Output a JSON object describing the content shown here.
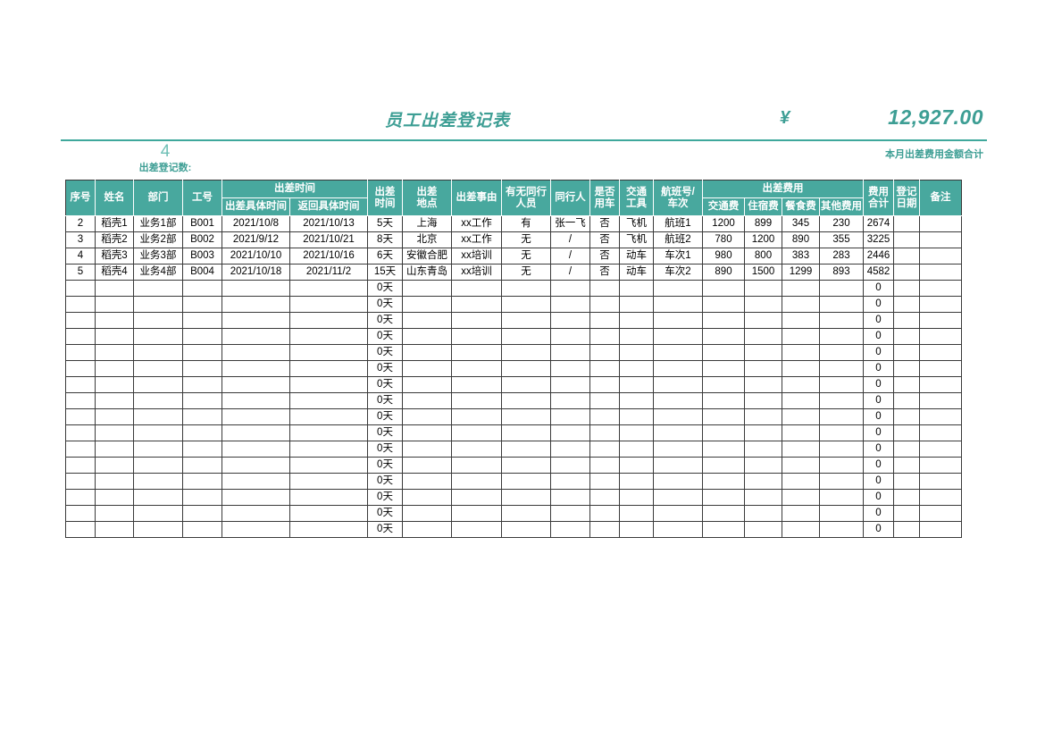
{
  "header": {
    "title": "员工出差登记表",
    "count_value": "4",
    "count_label": "出差登记数:",
    "currency_symbol": "¥",
    "total_amount": "12,927.00",
    "total_label": "本月出差费用金额合计",
    "accent_color": "#48A89E",
    "title_color": "#3D9E94"
  },
  "table": {
    "group_headers": {
      "trip_time": "出差时间",
      "expenses": "出差费用"
    },
    "columns": [
      {
        "key": "seq",
        "label": "序号"
      },
      {
        "key": "name",
        "label": "姓名"
      },
      {
        "key": "dept",
        "label": "部门"
      },
      {
        "key": "emp_id",
        "label": "工号"
      },
      {
        "key": "depart_time",
        "label": "出差具体时间"
      },
      {
        "key": "return_time",
        "label": "返回具体时间"
      },
      {
        "key": "duration",
        "label": "出差\n时间"
      },
      {
        "key": "location",
        "label": "出差\n地点"
      },
      {
        "key": "reason",
        "label": "出差事由"
      },
      {
        "key": "has_companion",
        "label": "有无同行\n人员"
      },
      {
        "key": "companion",
        "label": "同行人"
      },
      {
        "key": "use_car",
        "label": "是否\n用车"
      },
      {
        "key": "transport",
        "label": "交通\n工具"
      },
      {
        "key": "flight_no",
        "label": "航班号/\n车次"
      },
      {
        "key": "fee_transport",
        "label": "交通费"
      },
      {
        "key": "fee_hotel",
        "label": "住宿费"
      },
      {
        "key": "fee_meal",
        "label": "餐食费"
      },
      {
        "key": "fee_other",
        "label": "其他费用"
      },
      {
        "key": "fee_total",
        "label": "费用\n合计"
      },
      {
        "key": "reg_date",
        "label": "登记\n日期"
      },
      {
        "key": "remark",
        "label": "备注"
      }
    ],
    "rows": [
      [
        "2",
        "稻壳1",
        "业务1部",
        "B001",
        "2021/10/8",
        "2021/10/13",
        "5天",
        "上海",
        "xx工作",
        "有",
        "张一飞",
        "否",
        "飞机",
        "航班1",
        "1200",
        "899",
        "345",
        "230",
        "2674",
        "",
        ""
      ],
      [
        "3",
        "稻壳2",
        "业务2部",
        "B002",
        "2021/9/12",
        "2021/10/21",
        "8天",
        "北京",
        "xx工作",
        "无",
        "/",
        "否",
        "飞机",
        "航班2",
        "780",
        "1200",
        "890",
        "355",
        "3225",
        "",
        ""
      ],
      [
        "4",
        "稻壳3",
        "业务3部",
        "B003",
        "2021/10/10",
        "2021/10/16",
        "6天",
        "安徽合肥",
        "xx培训",
        "无",
        "/",
        "否",
        "动车",
        "车次1",
        "980",
        "800",
        "383",
        "283",
        "2446",
        "",
        ""
      ],
      [
        "5",
        "稻壳4",
        "业务4部",
        "B004",
        "2021/10/18",
        "2021/11/2",
        "15天",
        "山东青岛",
        "xx培训",
        "无",
        "/",
        "否",
        "动车",
        "车次2",
        "890",
        "1500",
        "1299",
        "893",
        "4582",
        "",
        ""
      ],
      [
        "",
        "",
        "",
        "",
        "",
        "",
        "0天",
        "",
        "",
        "",
        "",
        "",
        "",
        "",
        "",
        "",
        "",
        "",
        "0",
        "",
        ""
      ],
      [
        "",
        "",
        "",
        "",
        "",
        "",
        "0天",
        "",
        "",
        "",
        "",
        "",
        "",
        "",
        "",
        "",
        "",
        "",
        "0",
        "",
        ""
      ],
      [
        "",
        "",
        "",
        "",
        "",
        "",
        "0天",
        "",
        "",
        "",
        "",
        "",
        "",
        "",
        "",
        "",
        "",
        "",
        "0",
        "",
        ""
      ],
      [
        "",
        "",
        "",
        "",
        "",
        "",
        "0天",
        "",
        "",
        "",
        "",
        "",
        "",
        "",
        "",
        "",
        "",
        "",
        "0",
        "",
        ""
      ],
      [
        "",
        "",
        "",
        "",
        "",
        "",
        "0天",
        "",
        "",
        "",
        "",
        "",
        "",
        "",
        "",
        "",
        "",
        "",
        "0",
        "",
        ""
      ],
      [
        "",
        "",
        "",
        "",
        "",
        "",
        "0天",
        "",
        "",
        "",
        "",
        "",
        "",
        "",
        "",
        "",
        "",
        "",
        "0",
        "",
        ""
      ],
      [
        "",
        "",
        "",
        "",
        "",
        "",
        "0天",
        "",
        "",
        "",
        "",
        "",
        "",
        "",
        "",
        "",
        "",
        "",
        "0",
        "",
        ""
      ],
      [
        "",
        "",
        "",
        "",
        "",
        "",
        "0天",
        "",
        "",
        "",
        "",
        "",
        "",
        "",
        "",
        "",
        "",
        "",
        "0",
        "",
        ""
      ],
      [
        "",
        "",
        "",
        "",
        "",
        "",
        "0天",
        "",
        "",
        "",
        "",
        "",
        "",
        "",
        "",
        "",
        "",
        "",
        "0",
        "",
        ""
      ],
      [
        "",
        "",
        "",
        "",
        "",
        "",
        "0天",
        "",
        "",
        "",
        "",
        "",
        "",
        "",
        "",
        "",
        "",
        "",
        "0",
        "",
        ""
      ],
      [
        "",
        "",
        "",
        "",
        "",
        "",
        "0天",
        "",
        "",
        "",
        "",
        "",
        "",
        "",
        "",
        "",
        "",
        "",
        "0",
        "",
        ""
      ],
      [
        "",
        "",
        "",
        "",
        "",
        "",
        "0天",
        "",
        "",
        "",
        "",
        "",
        "",
        "",
        "",
        "",
        "",
        "",
        "0",
        "",
        ""
      ],
      [
        "",
        "",
        "",
        "",
        "",
        "",
        "0天",
        "",
        "",
        "",
        "",
        "",
        "",
        "",
        "",
        "",
        "",
        "",
        "0",
        "",
        ""
      ],
      [
        "",
        "",
        "",
        "",
        "",
        "",
        "0天",
        "",
        "",
        "",
        "",
        "",
        "",
        "",
        "",
        "",
        "",
        "",
        "0",
        "",
        ""
      ],
      [
        "",
        "",
        "",
        "",
        "",
        "",
        "0天",
        "",
        "",
        "",
        "",
        "",
        "",
        "",
        "",
        "",
        "",
        "",
        "0",
        "",
        ""
      ],
      [
        "",
        "",
        "",
        "",
        "",
        "",
        "0天",
        "",
        "",
        "",
        "",
        "",
        "",
        "",
        "",
        "",
        "",
        "",
        "0",
        "",
        ""
      ]
    ]
  }
}
